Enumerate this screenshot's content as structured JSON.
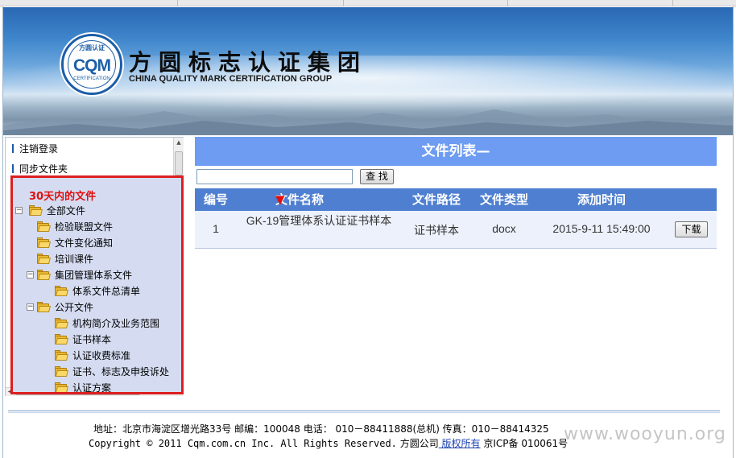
{
  "banner": {
    "logo_badge_top": "方圆认证",
    "logo_badge_text": "CQM",
    "logo_badge_bottom": "CERTIFICATION",
    "title_cn": "方圆标志认证集团",
    "title_en": "CHINA QUALITY MARK CERTIFICATION GROUP"
  },
  "sidebar": {
    "links": [
      "注销登录",
      "同步文件夹"
    ],
    "tree_title": "30天内的文件",
    "tree": [
      {
        "label": "全部文件",
        "toggle": "⊟"
      },
      {
        "label": "检验联盟文件",
        "toggle": ""
      },
      {
        "label": "文件变化通知",
        "toggle": ""
      },
      {
        "label": "培训课件",
        "toggle": ""
      },
      {
        "label": "集团管理体系文件",
        "toggle": "⊟"
      },
      {
        "label": "体系文件总清单",
        "toggle": ""
      },
      {
        "label": "公开文件",
        "toggle": "⊟"
      },
      {
        "label": "机构简介及业务范围",
        "toggle": ""
      },
      {
        "label": "证书样本",
        "toggle": ""
      },
      {
        "label": "认证收费标准",
        "toggle": ""
      },
      {
        "label": "证书、标志及申投诉处",
        "toggle": ""
      },
      {
        "label": "认证方案",
        "toggle": ""
      }
    ],
    "accent_color": "#dd1f1f"
  },
  "main": {
    "header_title": "文件列表—",
    "search": {
      "value": "",
      "button_label": "查 找"
    },
    "table": {
      "columns": [
        "编号",
        "文件名称",
        "文件路径",
        "文件类型",
        "添加时间"
      ],
      "sort_indicator": "▼",
      "rows": [
        {
          "id": "1",
          "name": "GK-19管理体系认证证书样本",
          "path": "证书样本",
          "type": "docx",
          "time": "2015-9-11 15:49:00",
          "action": "下载"
        }
      ]
    },
    "header_color": "#6d9cf2"
  },
  "footer": {
    "line1": "地址：北京市海淀区增光路33号    邮编：100048   电话： 010－88411888(总机)    传真：010－88414325",
    "line2_prefix": "Copyright © 2011 Cqm.com.cn Inc. All Rights Reserved.",
    "line2_company": " 方圆公司",
    "line2_link": " 版权所有",
    "line2_icp": " 京ICP备 010061号",
    "watermark": "www.wooyun.org"
  }
}
